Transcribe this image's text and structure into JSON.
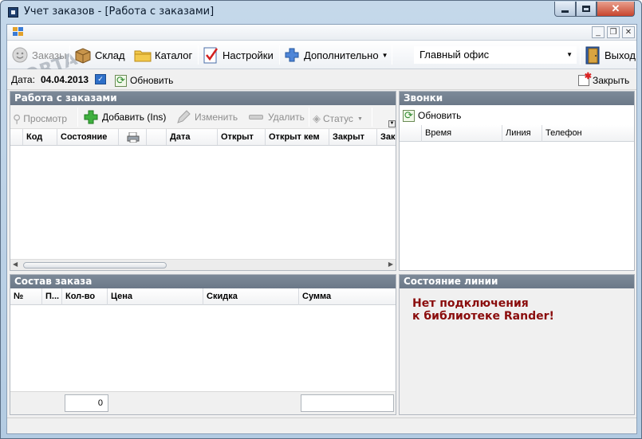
{
  "window": {
    "title": "Учет заказов - [Работа с заказами]",
    "watermark": "PORTAL"
  },
  "toolbar": {
    "orders": "Заказы",
    "warehouse": "Склад",
    "catalog": "Каталог",
    "settings": "Настройки",
    "additional": "Дополнительно",
    "office": "Главный офис",
    "exit": "Выход"
  },
  "datebar": {
    "date_label": "Дата:",
    "date_value": "04.04.2013",
    "refresh": "Обновить",
    "close": "Закрыть"
  },
  "orders_panel": {
    "title": "Работа с заказами",
    "actions": {
      "view": "Просмотр",
      "add": "Добавить (Ins)",
      "edit": "Изменить",
      "delete": "Удалить",
      "status": "Статус"
    },
    "columns": [
      "Код",
      "Состояние",
      "Дата",
      "Открыт",
      "Открыт кем",
      "Закрыт",
      "Зак"
    ]
  },
  "calls_panel": {
    "title": "Звонки",
    "refresh": "Обновить",
    "columns": [
      "Время",
      "Линия",
      "Телефон"
    ]
  },
  "composition_panel": {
    "title": "Состав заказа",
    "columns": [
      "№",
      "П...",
      "Кол-во",
      "Цена",
      "Скидка",
      "Сумма"
    ],
    "total_qty": "0",
    "total_sum": ""
  },
  "line_panel": {
    "title": "Состояние линии",
    "message_line1": "Нет подключения",
    "message_line2": "к библиотеке Rander!"
  },
  "colors": {
    "panel_header": "#75828f",
    "error_text": "#8a0c0c",
    "close_button": "#c7452e"
  }
}
